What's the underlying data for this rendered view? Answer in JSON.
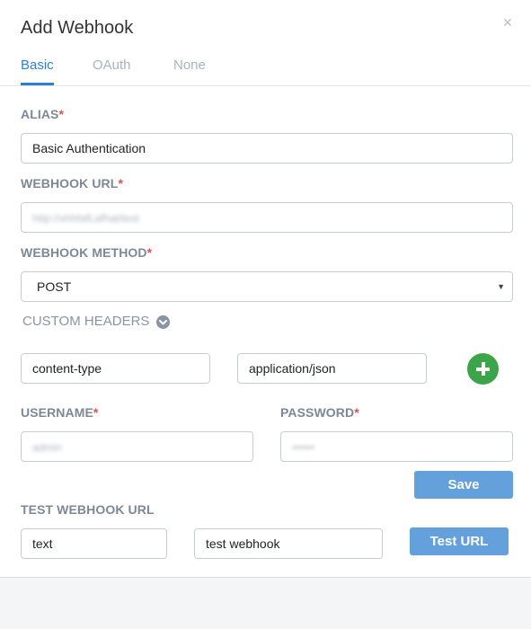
{
  "dialog": {
    "title": "Add Webhook"
  },
  "tabs": [
    {
      "label": "Basic",
      "active": true
    },
    {
      "label": "OAuth",
      "active": false
    },
    {
      "label": "None",
      "active": false
    }
  ],
  "form": {
    "alias": {
      "label": "ALIAS",
      "required": "*",
      "value": "Basic Authentication"
    },
    "webhook_url": {
      "label": "WEBHOOK URL",
      "required": "*",
      "value": "http://xhhfafLafhat/test"
    },
    "webhook_method": {
      "label": "WEBHOOK METHOD",
      "required": "*",
      "value": "POST"
    },
    "custom_headers": {
      "label": "CUSTOM HEADERS",
      "key_value": "content-type",
      "value_value": "application/json"
    },
    "username": {
      "label": "USERNAME",
      "required": "*",
      "value": "admin"
    },
    "password": {
      "label": "PASSWORD",
      "required": "*",
      "value": "••••••"
    },
    "save_label": "Save",
    "test": {
      "label": "TEST WEBHOOK URL",
      "field1_value": "text",
      "field2_value": "test webhook",
      "button_label": "Test URL"
    }
  },
  "colors": {
    "accent": "#2f7fd0",
    "button": "#64a0dc",
    "add": "#3ca54a",
    "required": "#d9534f"
  },
  "icons": {
    "close": "close-icon",
    "chevron": "chevron-down-icon",
    "add": "plus-icon"
  }
}
